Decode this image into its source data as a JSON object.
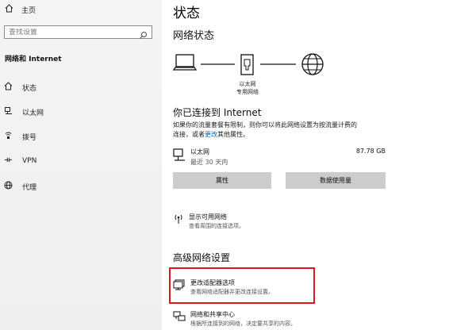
{
  "sidebar": {
    "home_label": "主页",
    "search_placeholder": "查找设置",
    "section_title": "网络和 Internet",
    "items": [
      {
        "label": "状态",
        "icon": "home-icon"
      },
      {
        "label": "以太网",
        "icon": "ethernet-icon"
      },
      {
        "label": "拨号",
        "icon": "dialup-icon"
      },
      {
        "label": "VPN",
        "icon": "vpn-icon"
      },
      {
        "label": "代理",
        "icon": "globe-icon"
      }
    ]
  },
  "main": {
    "title": "状态",
    "network_status_heading": "网络状态",
    "diagram_label_1": "以太网",
    "diagram_label_2": "专用网络",
    "connected_heading": "你已连接到 Internet",
    "description_line1": "如果你的流量套餐有限制，则你可以将此网络设置为按流量计费的",
    "description_line2_prefix": "连接，或者",
    "description_link": "更改",
    "description_line2_suffix": "其他属性。",
    "ethernet": {
      "name": "以太网",
      "sub": "最近 30 天内",
      "size": "87.78 GB"
    },
    "buttons": {
      "properties": "属性",
      "data_usage": "数据使用量"
    },
    "show_networks": {
      "title": "显示可用网络",
      "sub": "查看周围的连接选项。"
    },
    "advanced_heading": "高级网络设置",
    "adapter_options": {
      "title": "更改适配器选项",
      "sub": "查看网络适配器并更改连接设置。"
    },
    "sharing_center": {
      "title": "网络和共享中心",
      "sub": "根据所连接到的网络，决定要共享的内容。"
    }
  },
  "colors": {
    "accent": "#0067b8",
    "highlight_box": "#e0141b",
    "button_bg": "#cccccc"
  }
}
